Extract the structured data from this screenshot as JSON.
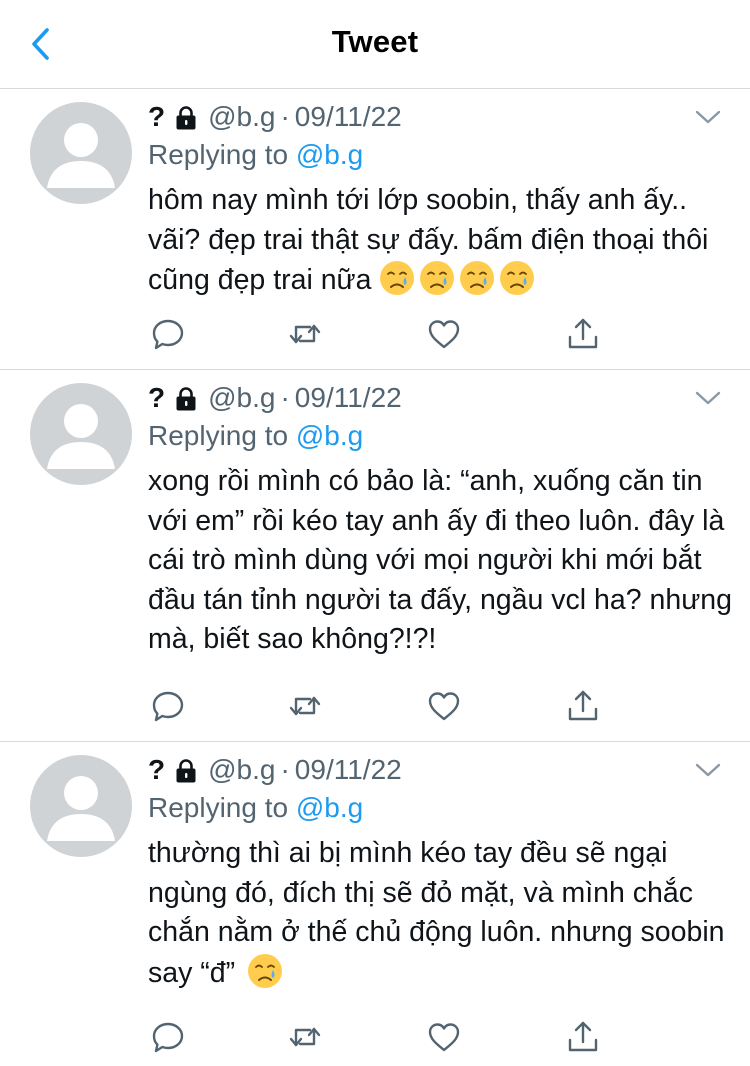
{
  "header": {
    "title": "Tweet",
    "back_icon": "chevron-left-icon",
    "accent_color": "#1d9bf0"
  },
  "tweets": [
    {
      "name": "?",
      "lock_icon": "lock-icon",
      "handle": "@b.g",
      "separator": "·",
      "date": "09/11/22",
      "replying_label": "Replying to",
      "replying_to": "@b.g",
      "text": "hôm nay mình tới lớp soobin, thấy anh ấy.. vãi? đẹp trai thật sự đấy. bấm điện thoại thôi cũng đẹp trai nữa",
      "emojis": [
        "crying-face-icon",
        "crying-face-icon",
        "crying-face-icon",
        "crying-face-icon"
      ]
    },
    {
      "name": "?",
      "lock_icon": "lock-icon",
      "handle": "@b.g",
      "separator": "·",
      "date": "09/11/22",
      "replying_label": "Replying to",
      "replying_to": "@b.g",
      "text": "xong rồi mình có bảo là: “anh, xuống căn tin với em” rồi kéo tay anh ấy đi theo luôn. đây là cái trò mình dùng với mọi người khi mới bắt đầu tán tỉnh người ta đấy, ngầu vcl ha? nhưng mà, biết sao không?!?!",
      "emojis": []
    },
    {
      "name": "?",
      "lock_icon": "lock-icon",
      "handle": "@b.g",
      "separator": "·",
      "date": "09/11/22",
      "replying_label": "Replying to",
      "replying_to": "@b.g",
      "text": "thường thì ai bị mình kéo tay đều sẽ ngại ngùng đó, đích thị sẽ đỏ mặt, và mình chắc chắn nằm ở thế chủ động luôn. nhưng soobin say “đ”",
      "emojis": [
        "crying-face-icon"
      ]
    }
  ],
  "action_icons": [
    "reply-icon",
    "retweet-icon",
    "like-icon",
    "share-icon"
  ],
  "colors": {
    "text": "#0f1419",
    "secondary": "#536471",
    "link": "#1d9bf0",
    "divider": "#d9d9d9",
    "avatar": "#cfd3d6"
  }
}
